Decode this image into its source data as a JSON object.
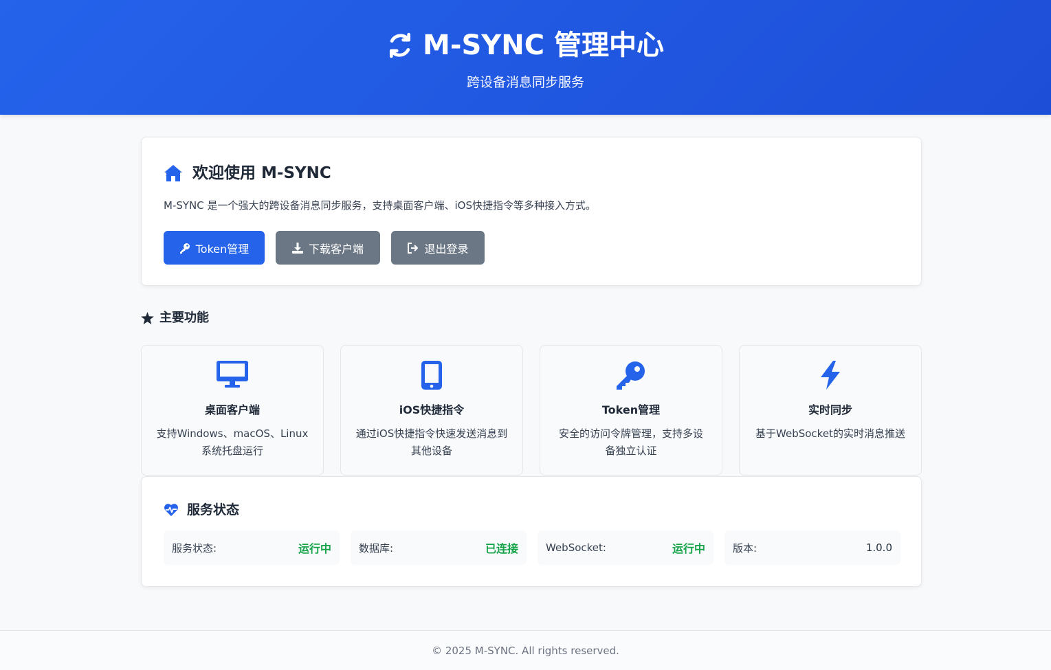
{
  "header": {
    "title": "M-SYNC 管理中心",
    "subtitle": "跨设备消息同步服务",
    "icon": "sync-icon"
  },
  "welcome": {
    "title": "欢迎使用 M-SYNC",
    "icon": "home-icon",
    "description": "M-SYNC 是一个强大的跨设备消息同步服务，支持桌面客户端、iOS快捷指令等多种接入方式。",
    "buttons": {
      "token": "Token管理",
      "download": "下载客户端",
      "logout": "退出登录"
    }
  },
  "features": {
    "title": "主要功能",
    "icon": "star-icon",
    "items": [
      {
        "title": "桌面客户端",
        "desc": "支持Windows、macOS、Linux系统托盘运行",
        "icon": "desktop-icon"
      },
      {
        "title": "iOS快捷指令",
        "desc": "通过iOS快捷指令快速发送消息到其他设备",
        "icon": "mobile-icon"
      },
      {
        "title": "Token管理",
        "desc": "安全的访问令牌管理，支持多设备独立认证",
        "icon": "key-icon"
      },
      {
        "title": "实时同步",
        "desc": "基于WebSocket的实时消息推送",
        "icon": "bolt-icon"
      }
    ]
  },
  "status": {
    "title": "服务状态",
    "icon": "heartbeat-icon",
    "items": [
      {
        "label": "服务状态:",
        "value": "运行中"
      },
      {
        "label": "数据库:",
        "value": "已连接"
      },
      {
        "label": "WebSocket:",
        "value": "运行中"
      },
      {
        "label": "版本:",
        "value": "1.0.0"
      }
    ]
  },
  "footer": {
    "text": "© 2025 M-SYNC. All rights reserved."
  },
  "colors": {
    "primary": "#2563eb",
    "secondary": "#6b7785",
    "success": "#16a34a"
  }
}
